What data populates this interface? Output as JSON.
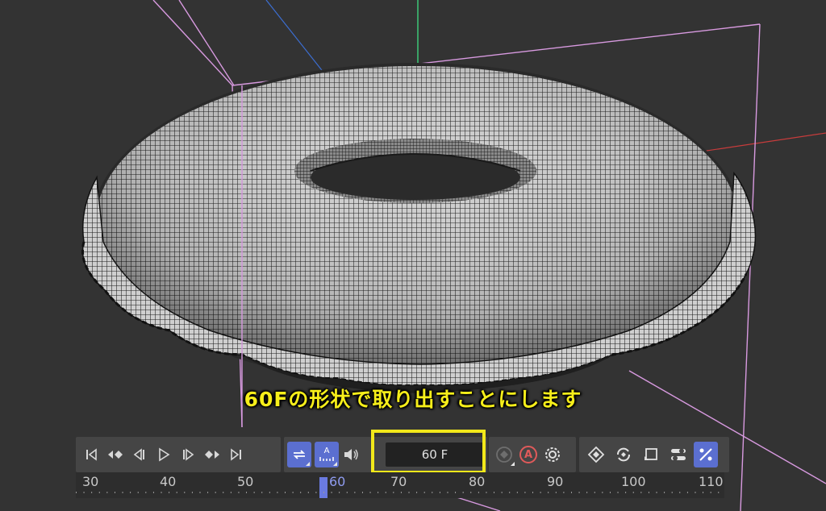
{
  "caption": "60Fの形状で取り出すことにします",
  "frame_field": {
    "value": "60 F"
  },
  "timeline": {
    "ticks": [
      "30",
      "40",
      "50",
      "60",
      "70",
      "80",
      "90",
      "100",
      "110"
    ],
    "current_frame": "60"
  },
  "playback_controls": [
    {
      "name": "go-to-start-icon"
    },
    {
      "name": "previous-keyframe-icon"
    },
    {
      "name": "previous-frame-icon"
    },
    {
      "name": "play-icon"
    },
    {
      "name": "next-frame-icon"
    },
    {
      "name": "next-keyframe-icon"
    },
    {
      "name": "go-to-end-icon"
    }
  ],
  "mode_controls": [
    {
      "name": "loop-icon",
      "active": true
    },
    {
      "name": "playback-rate-icon",
      "label": "A",
      "active": true
    },
    {
      "name": "sound-icon"
    }
  ],
  "record_controls": [
    {
      "name": "record-keys-icon"
    },
    {
      "name": "autokey-icon",
      "label": "A"
    },
    {
      "name": "key-settings-icon"
    }
  ],
  "key_controls": [
    {
      "name": "position-key-icon"
    },
    {
      "name": "rotation-key-icon"
    },
    {
      "name": "scale-key-icon"
    },
    {
      "name": "parameter-key-icon"
    },
    {
      "name": "point-level-key-icon",
      "active": true
    }
  ],
  "colors": {
    "caption": "#f6ee1a",
    "highlight": "#f2e81a",
    "active_button": "#5b6fd0",
    "background": "#333333",
    "wireframe": "#1a1a1a",
    "axis_x": "#c83c3c",
    "axis_y": "#3cc878",
    "axis_z": "#3c6ed2",
    "bounding_box": "#d89ae0"
  }
}
